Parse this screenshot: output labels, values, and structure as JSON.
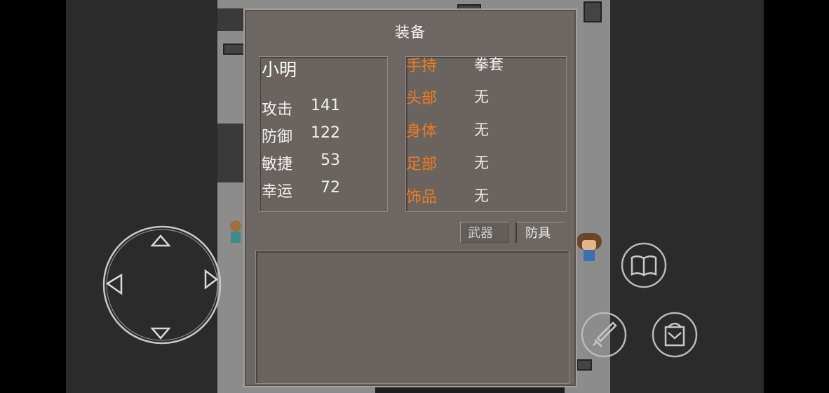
{
  "panel": {
    "title": "装备"
  },
  "character": {
    "name": "小明",
    "stats": [
      {
        "label": "攻击",
        "value": "141"
      },
      {
        "label": "防御",
        "value": "122"
      },
      {
        "label": "敏捷",
        "value": "53"
      },
      {
        "label": "幸运",
        "value": "72"
      }
    ]
  },
  "equipment": {
    "slots": [
      {
        "label": "手持",
        "value": "拳套"
      },
      {
        "label": "头部",
        "value": "无"
      },
      {
        "label": "身体",
        "value": "无"
      },
      {
        "label": "足部",
        "value": "无"
      },
      {
        "label": "饰品",
        "value": "无"
      }
    ]
  },
  "tabs": {
    "weapon": "武器",
    "armor": "防具"
  },
  "controls": {
    "joystick_icon": "dpad-icon",
    "book_icon": "book-icon",
    "sword_icon": "sword-icon",
    "bag_icon": "bag-icon"
  },
  "colors": {
    "slot_label": "#f07b1e",
    "panel_bg": "#6c6762",
    "text": "#f0f0f0"
  }
}
